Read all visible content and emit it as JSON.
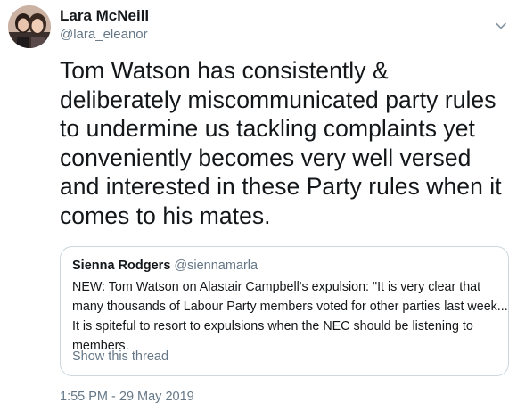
{
  "author": {
    "display_name": "Lara McNeill",
    "handle": "@lara_eleanor",
    "avatar_icon": "profile-photo"
  },
  "menu": {
    "icon": "chevron-down-icon"
  },
  "tweet": {
    "text": "Tom Watson has consistently & deliberately miscommunicated party rules to undermine us tackling complaints yet conveniently becomes very well versed and interested in these Party rules when it comes to his mates.",
    "timestamp": "1:55 PM - 29 May 2019"
  },
  "quoted_tweet": {
    "display_name": "Sienna Rodgers",
    "handle": "@siennamarla",
    "lines": [
      "NEW: Tom Watson on Alastair Campbell's expulsion: \"It is very clear that",
      "many thousands of Labour Party members voted for other parties last week...",
      "It is spiteful to resort to expulsions when the NEC should be listening to",
      "members."
    ],
    "show_thread_label": "Show this thread"
  },
  "colors": {
    "primary_text": "#14171a",
    "secondary_text": "#657786",
    "border": "#ccd6dd"
  }
}
